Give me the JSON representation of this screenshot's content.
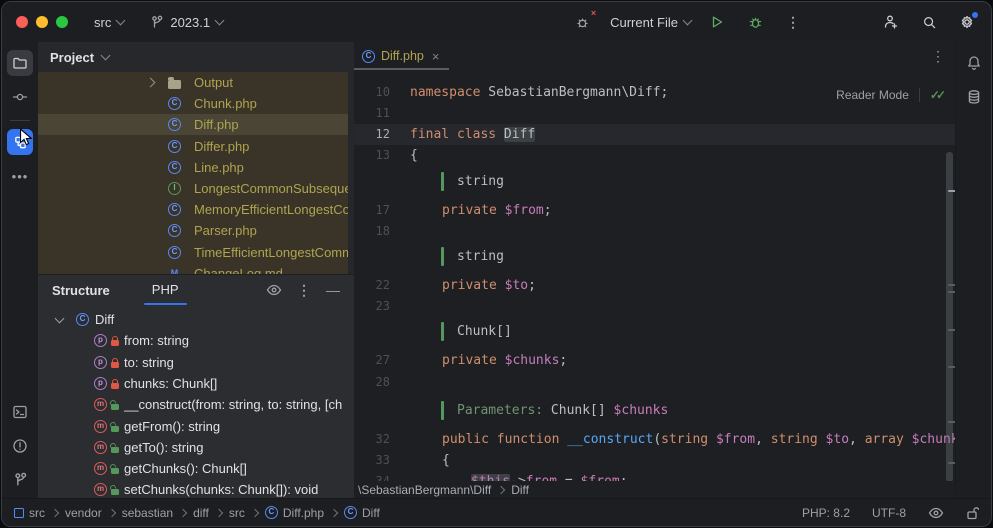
{
  "colors": {
    "accent_blue": "#3574F0",
    "keyword_orange": "#CF8E6D",
    "variable_purple": "#C77DBB",
    "function_blue": "#56A8F5",
    "code_text": "#BCBEC4",
    "doc_green": "#6F9472",
    "run_green": "#5FAD65",
    "method_red": "#DB5C5C",
    "tree_text_yellow": "#AFA44F",
    "tree_bg_brown": "#3A3328",
    "tree_selected_row": "#4B4536",
    "caret_line": "#26282E",
    "traffic_lights": [
      "#FC5F57",
      "#FEBC2E",
      "#28C840"
    ]
  },
  "titlebar": {
    "project": "src",
    "branch": "2023.1",
    "run_config": "Current File"
  },
  "icon_glyphs": {
    "class": "C",
    "interface": "I",
    "property": "p",
    "method": "m",
    "markdown": "M"
  },
  "project_panel": {
    "title": "Project",
    "items": [
      {
        "type": "folder",
        "label": "Output",
        "chevron": true
      },
      {
        "type": "class",
        "label": "Chunk.php"
      },
      {
        "type": "class",
        "label": "Diff.php",
        "selected": true
      },
      {
        "type": "class",
        "label": "Differ.php"
      },
      {
        "type": "class",
        "label": "Line.php"
      },
      {
        "type": "interface",
        "label": "LongestCommonSubsequence"
      },
      {
        "type": "class",
        "label": "MemoryEfficientLongestComm"
      },
      {
        "type": "class",
        "label": "Parser.php"
      },
      {
        "type": "class",
        "label": "TimeEfficientLongestCommon"
      },
      {
        "type": "markdown",
        "label": "ChangeLog.md"
      }
    ]
  },
  "structure_panel": {
    "title": "Structure",
    "tab": "PHP",
    "root": {
      "type": "class",
      "label": "Diff"
    },
    "members": [
      {
        "kind": "property",
        "visibility": "private",
        "label": "from: string"
      },
      {
        "kind": "property",
        "visibility": "private",
        "label": "to: string"
      },
      {
        "kind": "property",
        "visibility": "private",
        "label": "chunks: Chunk[]"
      },
      {
        "kind": "method",
        "visibility": "public",
        "label": "__construct(from: string, to: string, [ch"
      },
      {
        "kind": "method",
        "visibility": "public",
        "label": "getFrom(): string"
      },
      {
        "kind": "method",
        "visibility": "public",
        "label": "getTo(): string"
      },
      {
        "kind": "method",
        "visibility": "public",
        "label": "getChunks(): Chunk[]"
      },
      {
        "kind": "method",
        "visibility": "public",
        "label": "setChunks(chunks: Chunk[]): void"
      }
    ]
  },
  "editor": {
    "tab": "Diff.php",
    "reader_mode": "Reader Mode",
    "breadcrumbs": [
      "\\SebastianBergmann\\Diff",
      "Diff"
    ],
    "lines": [
      {
        "num": "10",
        "indent": 0,
        "tokens": [
          {
            "t": "namespace",
            "c": "kw"
          },
          {
            "t": " SebastianBergmann\\Diff;",
            "c": "tx"
          }
        ]
      },
      {
        "num": "11",
        "indent": 0,
        "tokens": []
      },
      {
        "num": "12",
        "indent": 0,
        "caret": true,
        "tokens": [
          {
            "t": "final class",
            "c": "kw"
          },
          {
            "t": " ",
            "c": "tx"
          },
          {
            "t": "Diff",
            "c": "tx",
            "hl": true
          }
        ]
      },
      {
        "num": "13",
        "indent": 0,
        "tokens": [
          {
            "t": "{",
            "c": "tx"
          }
        ]
      },
      {
        "doc": true,
        "indent": 1,
        "tokens": [
          {
            "t": "string",
            "c": "tx"
          }
        ]
      },
      {
        "num": "17",
        "indent": 1,
        "tokens": [
          {
            "t": "private",
            "c": "kw"
          },
          {
            "t": " ",
            "c": "tx"
          },
          {
            "t": "$from",
            "c": "var"
          },
          {
            "t": ";",
            "c": "tx"
          }
        ]
      },
      {
        "num": "18",
        "indent": 0,
        "tokens": []
      },
      {
        "doc": true,
        "indent": 1,
        "tokens": [
          {
            "t": "string",
            "c": "tx"
          }
        ]
      },
      {
        "num": "22",
        "indent": 1,
        "tokens": [
          {
            "t": "private",
            "c": "kw"
          },
          {
            "t": " ",
            "c": "tx"
          },
          {
            "t": "$to",
            "c": "var"
          },
          {
            "t": ";",
            "c": "tx"
          }
        ]
      },
      {
        "num": "23",
        "indent": 0,
        "tokens": []
      },
      {
        "doc": true,
        "indent": 1,
        "tokens": [
          {
            "t": "Chunk[]",
            "c": "tx"
          }
        ]
      },
      {
        "num": "27",
        "indent": 1,
        "tokens": [
          {
            "t": "private",
            "c": "kw"
          },
          {
            "t": " ",
            "c": "tx"
          },
          {
            "t": "$chunks",
            "c": "var"
          },
          {
            "t": ";",
            "c": "tx"
          }
        ]
      },
      {
        "num": "28",
        "indent": 0,
        "tokens": []
      },
      {
        "doc": true,
        "indent": 1,
        "tokens": [
          {
            "t": "Parameters: ",
            "c": "doc"
          },
          {
            "t": "Chunk[] ",
            "c": "tx"
          },
          {
            "t": "$chunks",
            "c": "var"
          }
        ]
      },
      {
        "num": "32",
        "indent": 1,
        "tokens": [
          {
            "t": "public function ",
            "c": "kw"
          },
          {
            "t": "__construct",
            "c": "fn"
          },
          {
            "t": "(",
            "c": "tx"
          },
          {
            "t": "string",
            "c": "kw"
          },
          {
            "t": " ",
            "c": "tx"
          },
          {
            "t": "$from",
            "c": "var"
          },
          {
            "t": ", ",
            "c": "tx"
          },
          {
            "t": "string",
            "c": "kw"
          },
          {
            "t": " ",
            "c": "tx"
          },
          {
            "t": "$to",
            "c": "var"
          },
          {
            "t": ", ",
            "c": "tx"
          },
          {
            "t": "array",
            "c": "kw"
          },
          {
            "t": " ",
            "c": "tx"
          },
          {
            "t": "$chunks",
            "c": "var"
          }
        ]
      },
      {
        "num": "33",
        "indent": 1,
        "tokens": [
          {
            "t": "{",
            "c": "tx"
          }
        ]
      },
      {
        "num": "34",
        "indent": 2,
        "tokens": [
          {
            "t": "$this",
            "c": "var",
            "hl": true
          },
          {
            "t": "->",
            "c": "tx"
          },
          {
            "t": "from",
            "c": "var"
          },
          {
            "t": " = ",
            "c": "tx"
          },
          {
            "t": "$from",
            "c": "var"
          },
          {
            "t": ";",
            "c": "tx"
          }
        ]
      }
    ]
  },
  "status_bar": {
    "path": [
      {
        "label": "src",
        "icon": "module"
      },
      {
        "label": "vendor"
      },
      {
        "label": "sebastian"
      },
      {
        "label": "diff"
      },
      {
        "label": "src"
      },
      {
        "label": "Diff.php",
        "icon": "class"
      },
      {
        "label": "Diff",
        "icon": "class"
      }
    ],
    "php_version": "PHP: 8.2",
    "encoding": "UTF-8"
  }
}
